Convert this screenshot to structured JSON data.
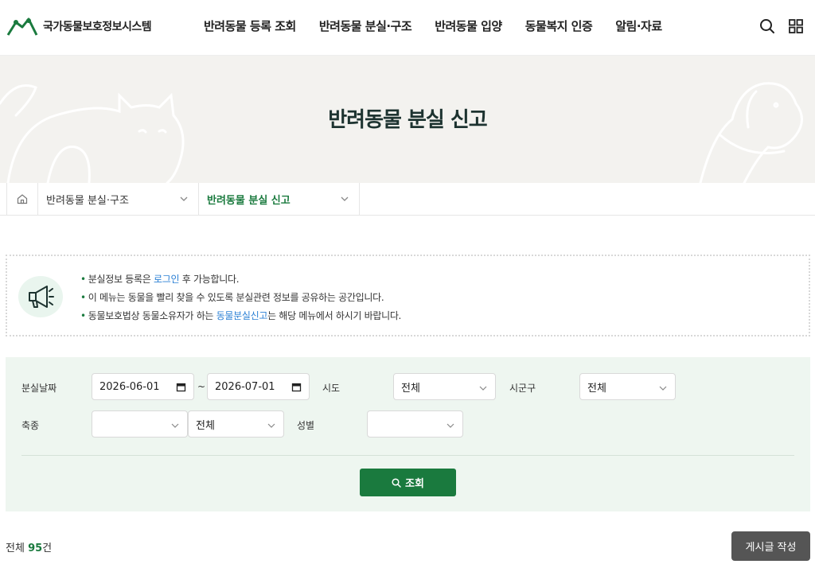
{
  "header": {
    "logo_text": "국가동물보호정보시스템",
    "nav": [
      "반려동물 등록 조회",
      "반려동물 분실·구조",
      "반려동물 입양",
      "동물복지 인증",
      "알림·자료"
    ]
  },
  "banner": {
    "title": "반려동물 분실 신고"
  },
  "breadcrumb": {
    "level1": "반려동물 분실·구조",
    "level2": "반려동물 분실 신고"
  },
  "notice": {
    "line1_pre": "분실정보 등록은 ",
    "line1_link": "로그인",
    "line1_post": " 후 가능합니다.",
    "line2": "이 메뉴는 동물을 빨리 찾을 수 있도록 분실관련 정보를 공유하는 공간입니다.",
    "line3_pre": "동물보호법상 동물소유자가 하는 ",
    "line3_link": "동물분실신고",
    "line3_post": "는 해당 메뉴에서 하시기 바랍니다."
  },
  "search": {
    "date_label": "분실날짜",
    "date_from": "2026-06-01",
    "date_sep": "~",
    "date_to": "2026-07-01",
    "sido_label": "시도",
    "sido_value": "전체",
    "sigungu_label": "시군구",
    "sigungu_value": "전체",
    "species_label": "축종",
    "species_value": "",
    "breed_value": "전체",
    "sex_label": "성별",
    "sex_value": "",
    "submit_label": "조회"
  },
  "results": {
    "total_prefix": "전체 ",
    "total_count": "95",
    "total_suffix": "건",
    "write_label": "게시글 작성"
  },
  "colors": {
    "brand": "#1a7a3e",
    "link": "#2a7fd4",
    "panel_bg": "#eef6f0",
    "banner_bg": "#f3f2ef"
  }
}
